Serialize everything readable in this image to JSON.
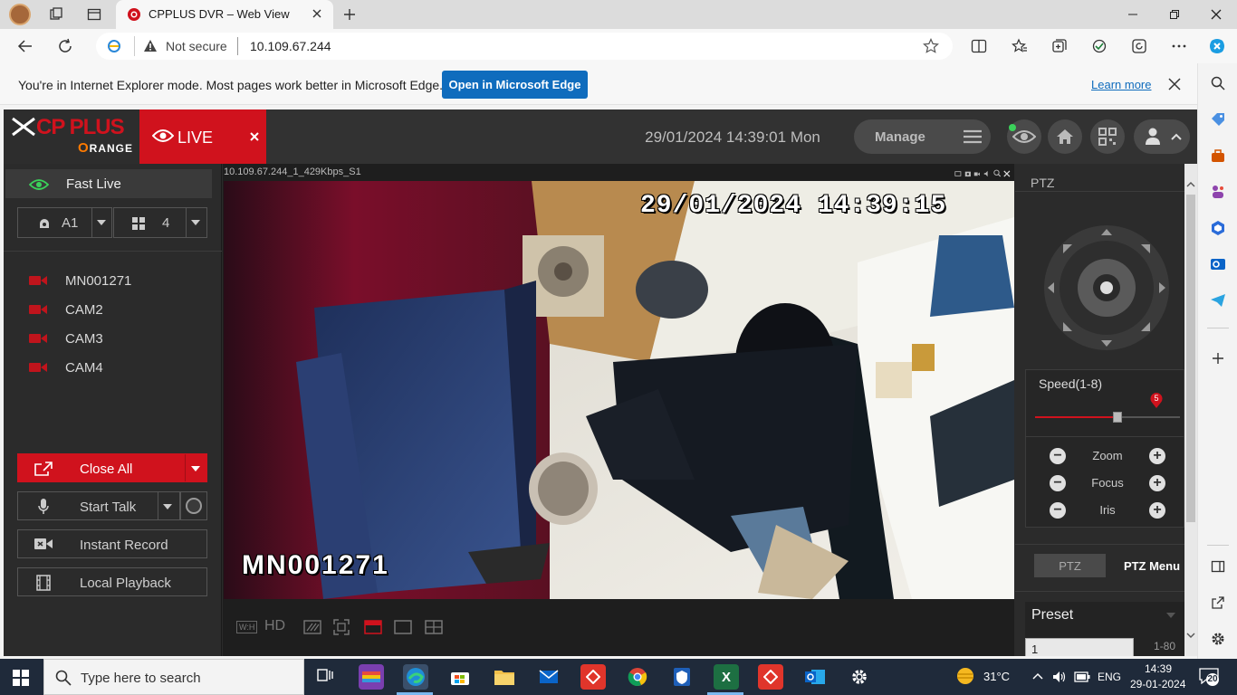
{
  "browser": {
    "tab_title": "CPPLUS DVR – Web View",
    "address": {
      "security_label": "Not secure",
      "url": "10.109.67.244"
    }
  },
  "ie_infobar": {
    "message": "You're in Internet Explorer mode. Most pages work better in Microsoft Edge.",
    "open_button": "Open in Microsoft Edge",
    "learn_more": "Learn more"
  },
  "dvr": {
    "brand": "CP PLUS",
    "brand_sub": "RANGE",
    "brand_sub_initial": "O",
    "live_tab": "LIVE",
    "datetime": "29/01/2024 14:39:01 Mon",
    "manage_label": "Manage",
    "left": {
      "fast_live": "Fast Live",
      "stream_select": "A1",
      "layout_select": "4",
      "cameras": [
        "MN001271",
        "CAM2",
        "CAM3",
        "CAM4"
      ],
      "close_all": "Close All",
      "start_talk": "Start Talk",
      "instant_record": "Instant Record",
      "local_playback": "Local Playback"
    },
    "video": {
      "title": "10.109.67.244_1_429Kbps_S1",
      "osd_time": "29/01/2024 14:39:15",
      "osd_name": "MN001271",
      "toolbar": {
        "wh": "W:H",
        "hd": "HD"
      }
    },
    "ptz": {
      "title": "PTZ",
      "speed_label": "Speed(1-8)",
      "speed_value": "5",
      "speed_fraction": 0.57,
      "zoom": "Zoom",
      "focus": "Focus",
      "iris": "Iris",
      "tab_ptz": "PTZ",
      "tab_menu": "PTZ Menu",
      "preset_label": "Preset",
      "preset_value": "1",
      "preset_range": "1-80"
    }
  },
  "taskbar": {
    "search_placeholder": "Type here to search",
    "weather": "31°C",
    "lang": "ENG",
    "time": "14:39",
    "date": "29-01-2024",
    "notifications": "20"
  }
}
